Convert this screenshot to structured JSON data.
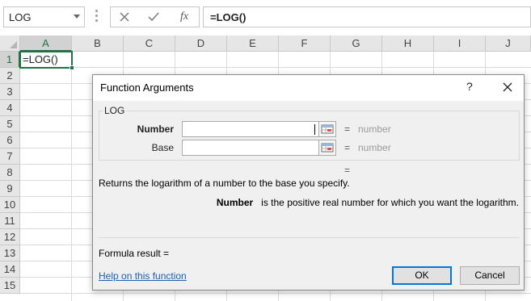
{
  "formula_bar": {
    "name_box": "LOG",
    "cancel_icon": "close-x-icon",
    "enter_icon": "checkmark-icon",
    "fx_label": "fx",
    "formula": "=LOG()"
  },
  "sheet": {
    "columns": [
      "A",
      "B",
      "C",
      "D",
      "E",
      "F",
      "G",
      "H",
      "I",
      "J"
    ],
    "rows": [
      "1",
      "2",
      "3",
      "4",
      "5",
      "6",
      "7",
      "8",
      "9",
      "10",
      "11",
      "12",
      "13",
      "14",
      "15"
    ],
    "active_cell_value": "=LOG()",
    "accent_color": "#217346"
  },
  "dialog": {
    "title": "Function Arguments",
    "help_button": "?",
    "function_name": "LOG",
    "args": [
      {
        "label": "Number",
        "value": "",
        "result_eq": "=",
        "result": "number",
        "bold": true
      },
      {
        "label": "Base",
        "value": "",
        "result_eq": "=",
        "result": "number",
        "bold": false
      }
    ],
    "function_result_eq": "=",
    "description": "Returns the logarithm of a number to the base you specify.",
    "arg_description_name": "Number",
    "arg_description_text": "is the positive real number for which you want the logarithm.",
    "formula_result": "Formula result =",
    "help_link": "Help on this function",
    "ok_label": "OK",
    "cancel_label": "Cancel"
  }
}
